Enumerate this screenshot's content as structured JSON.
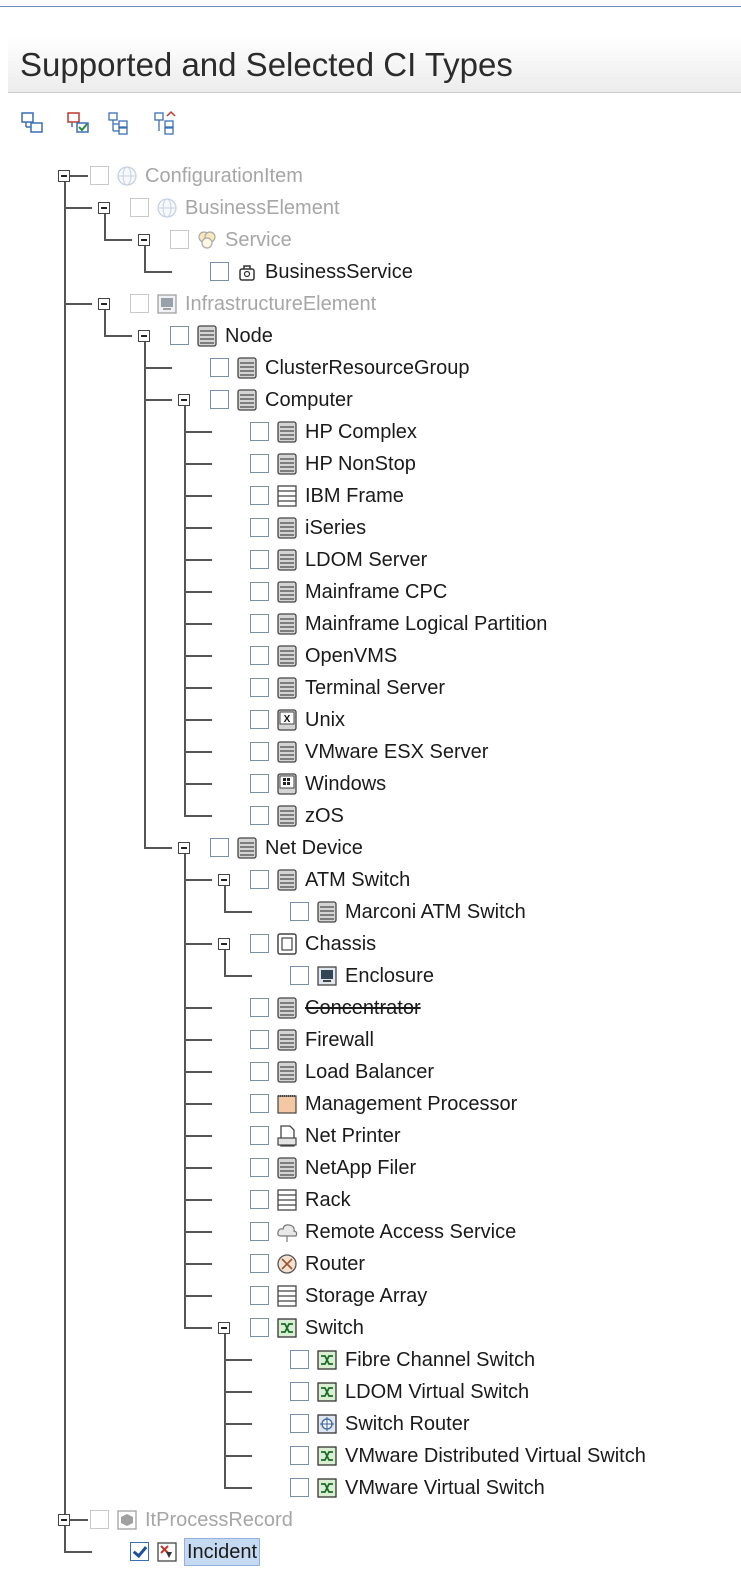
{
  "panel": {
    "title": "Supported and Selected CI Types"
  },
  "toolbar": {
    "buttons": [
      {
        "icon": "expand-tree-icon"
      },
      {
        "icon": "refresh-select-icon"
      },
      {
        "icon": "expand-all-icon"
      },
      {
        "icon": "collapse-all-icon"
      }
    ]
  },
  "tree": {
    "nodes": [
      {
        "label": "ConfigurationItem",
        "icon": "globe-icon",
        "disabled": true
      },
      {
        "label": "BusinessElement",
        "icon": "globe-icon",
        "disabled": true
      },
      {
        "label": "Service",
        "icon": "service-icon",
        "disabled": true
      },
      {
        "label": "BusinessService",
        "icon": "business-service-icon"
      },
      {
        "label": "InfrastructureElement",
        "icon": "monitor-icon",
        "disabled": true
      },
      {
        "label": "Node",
        "icon": "server-icon"
      },
      {
        "label": "ClusterResourceGroup",
        "icon": "server-icon"
      },
      {
        "label": "Computer",
        "icon": "server-icon"
      },
      {
        "label": "HP Complex",
        "icon": "server-icon"
      },
      {
        "label": "HP NonStop",
        "icon": "server-icon"
      },
      {
        "label": "IBM Frame",
        "icon": "rack-icon"
      },
      {
        "label": "iSeries",
        "icon": "server-icon"
      },
      {
        "label": "LDOM Server",
        "icon": "server-icon"
      },
      {
        "label": "Mainframe CPC",
        "icon": "server-icon"
      },
      {
        "label": "Mainframe Logical Partition",
        "icon": "server-icon"
      },
      {
        "label": "OpenVMS",
        "icon": "server-icon"
      },
      {
        "label": "Terminal Server",
        "icon": "server-icon"
      },
      {
        "label": "Unix",
        "icon": "unix-icon"
      },
      {
        "label": "VMware ESX Server",
        "icon": "server-icon"
      },
      {
        "label": "Windows",
        "icon": "windows-icon"
      },
      {
        "label": "zOS",
        "icon": "server-icon"
      },
      {
        "label": "Net Device",
        "icon": "server-icon"
      },
      {
        "label": "ATM Switch",
        "icon": "server-icon"
      },
      {
        "label": "Marconi ATM Switch",
        "icon": "server-icon"
      },
      {
        "label": "Chassis",
        "icon": "chassis-icon"
      },
      {
        "label": "Enclosure",
        "icon": "monitor-icon"
      },
      {
        "label": "Concentrator",
        "icon": "server-icon",
        "strike": true
      },
      {
        "label": "Firewall",
        "icon": "server-icon"
      },
      {
        "label": "Load Balancer",
        "icon": "server-icon"
      },
      {
        "label": "Management Processor",
        "icon": "processor-icon"
      },
      {
        "label": "Net Printer",
        "icon": "printer-icon"
      },
      {
        "label": "NetApp Filer",
        "icon": "server-icon"
      },
      {
        "label": "Rack",
        "icon": "rack-icon"
      },
      {
        "label": "Remote Access Service",
        "icon": "cloud-icon"
      },
      {
        "label": "Router",
        "icon": "router-icon"
      },
      {
        "label": "Storage Array",
        "icon": "rack-icon"
      },
      {
        "label": "Switch",
        "icon": "switch-icon"
      },
      {
        "label": "Fibre Channel Switch",
        "icon": "switch-icon"
      },
      {
        "label": "LDOM Virtual Switch",
        "icon": "switch-icon"
      },
      {
        "label": "Switch Router",
        "icon": "switch-router-icon"
      },
      {
        "label": "VMware Distributed Virtual Switch",
        "icon": "switch-icon"
      },
      {
        "label": "VMware Virtual Switch",
        "icon": "switch-icon"
      },
      {
        "label": "ItProcessRecord",
        "icon": "process-record-icon",
        "disabled": true
      },
      {
        "label": "Incident",
        "icon": "incident-icon",
        "checked": true,
        "selected": true
      }
    ]
  }
}
